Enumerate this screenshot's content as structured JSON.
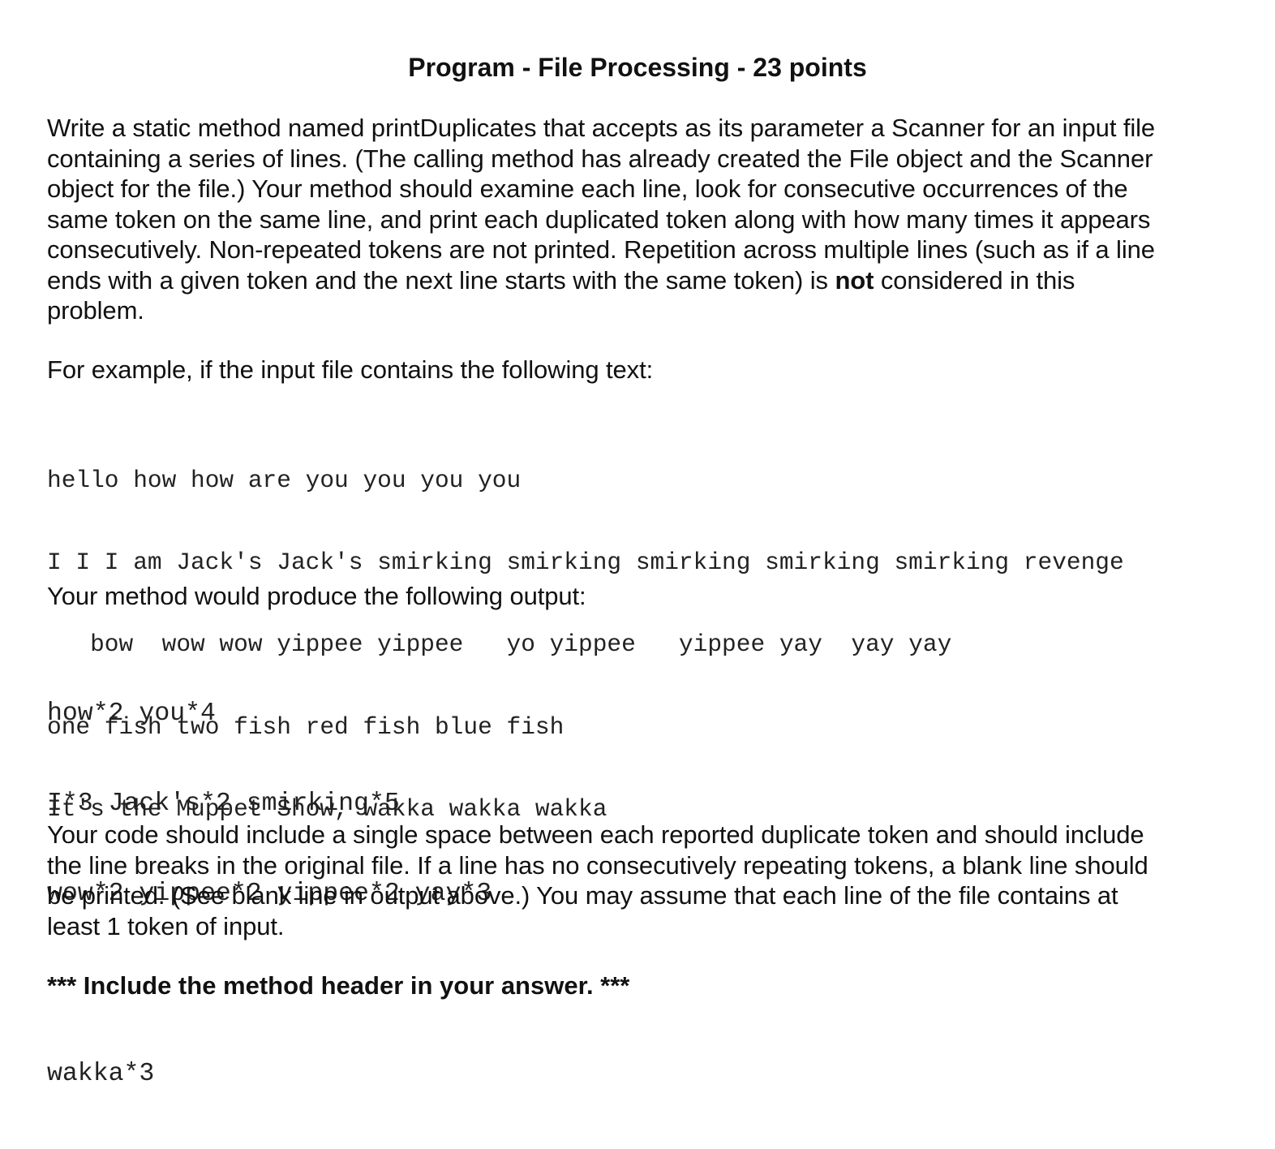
{
  "title": "Program - File Processing - 23 points",
  "intro": {
    "lines": [
      "Write a static method named printDuplicates that accepts as its parameter a Scanner for an input file",
      "containing a series of lines.  (The calling method has already created the File object and the Scanner",
      "object for the file.) Your method should examine each line, look for consecutive occurrences of the",
      "same token on the same line, and print each duplicated token along with how many times it appears",
      "consecutively.  Non-repeated tokens are not printed.  Repetition across multiple lines (such as if a line"
    ],
    "line6_before": "ends with a given token and the next line starts with the same token) is ",
    "line6_bold": "not",
    "line6_after": " considered in this",
    "line7": "problem."
  },
  "example_intro": "For example, if the input file contains the following text:",
  "input_file_lines": [
    "hello how how are you you you you",
    "I I I am Jack's Jack's smirking smirking smirking smirking smirking revenge",
    "   bow  wow wow yippee yippee   yo yippee   yippee yay  yay yay",
    "one fish two fish red fish blue fish",
    "It's the Muppet Show, wakka wakka wakka"
  ],
  "output_intro": "Your method would produce the following output:",
  "output_lines": [
    "how*2 you*4",
    "I*3 Jack's*2 smirking*5",
    "wow*2 yippee*2 yippee*2 yay*3",
    "",
    "wakka*3"
  ],
  "notes": {
    "lines": [
      "Your code should include a single space between each reported duplicate token and should include",
      "the line breaks in the original file.  If a line has no consecutively repeating tokens, a blank line should",
      "be printed. (See blank line in output above.)  You may assume that each line of the file contains at",
      "least 1 token of input."
    ]
  },
  "footer": "*** Include the method header in your answer. ***"
}
